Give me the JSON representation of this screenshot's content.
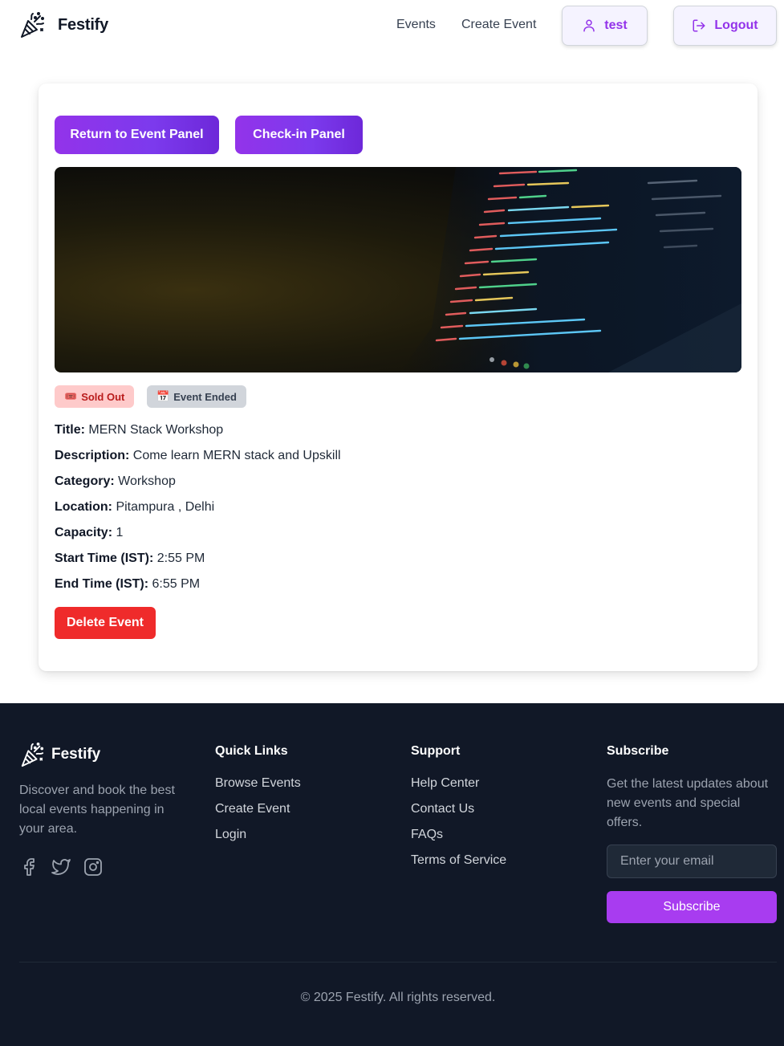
{
  "header": {
    "brand": "Festify",
    "nav": {
      "events": "Events",
      "create_event": "Create Event"
    },
    "user_label": "test",
    "logout_label": "Logout"
  },
  "event_panel": {
    "return_button": "Return to Event Panel",
    "checkin_button": "Check-in Panel",
    "badges": {
      "sold_out_icon": "🎟️",
      "sold_out": "Sold Out",
      "ended_icon": "📅",
      "ended": "Event Ended"
    },
    "fields": [
      {
        "label": "Title:",
        "value": "MERN Stack Workshop"
      },
      {
        "label": "Description:",
        "value": "Come learn MERN stack and Upskill"
      },
      {
        "label": "Category:",
        "value": "Workshop"
      },
      {
        "label": "Location:",
        "value": "Pitampura , Delhi"
      },
      {
        "label": "Capacity:",
        "value": "1"
      },
      {
        "label": "Start Time (IST):",
        "value": "2:55 PM"
      },
      {
        "label": "End Time (IST):",
        "value": "6:55 PM"
      }
    ],
    "delete_button": "Delete Event"
  },
  "footer": {
    "brand": "Festify",
    "description": "Discover and book the best local events happening in your area.",
    "social": [
      "facebook-icon",
      "twitter-icon",
      "instagram-icon"
    ],
    "quick_links": {
      "title": "Quick Links",
      "items": [
        "Browse Events",
        "Create Event",
        "Login"
      ]
    },
    "support": {
      "title": "Support",
      "items": [
        "Help Center",
        "Contact Us",
        "FAQs",
        "Terms of Service"
      ]
    },
    "subscribe": {
      "title": "Subscribe",
      "description": "Get the latest updates about new events and special offers.",
      "placeholder": "Enter your email",
      "button": "Subscribe"
    },
    "copyright": "© 2025 Festify. All rights reserved."
  },
  "colors": {
    "accent": "#9333ea",
    "danger": "#ef2b2b",
    "footer_bg": "#111827"
  }
}
